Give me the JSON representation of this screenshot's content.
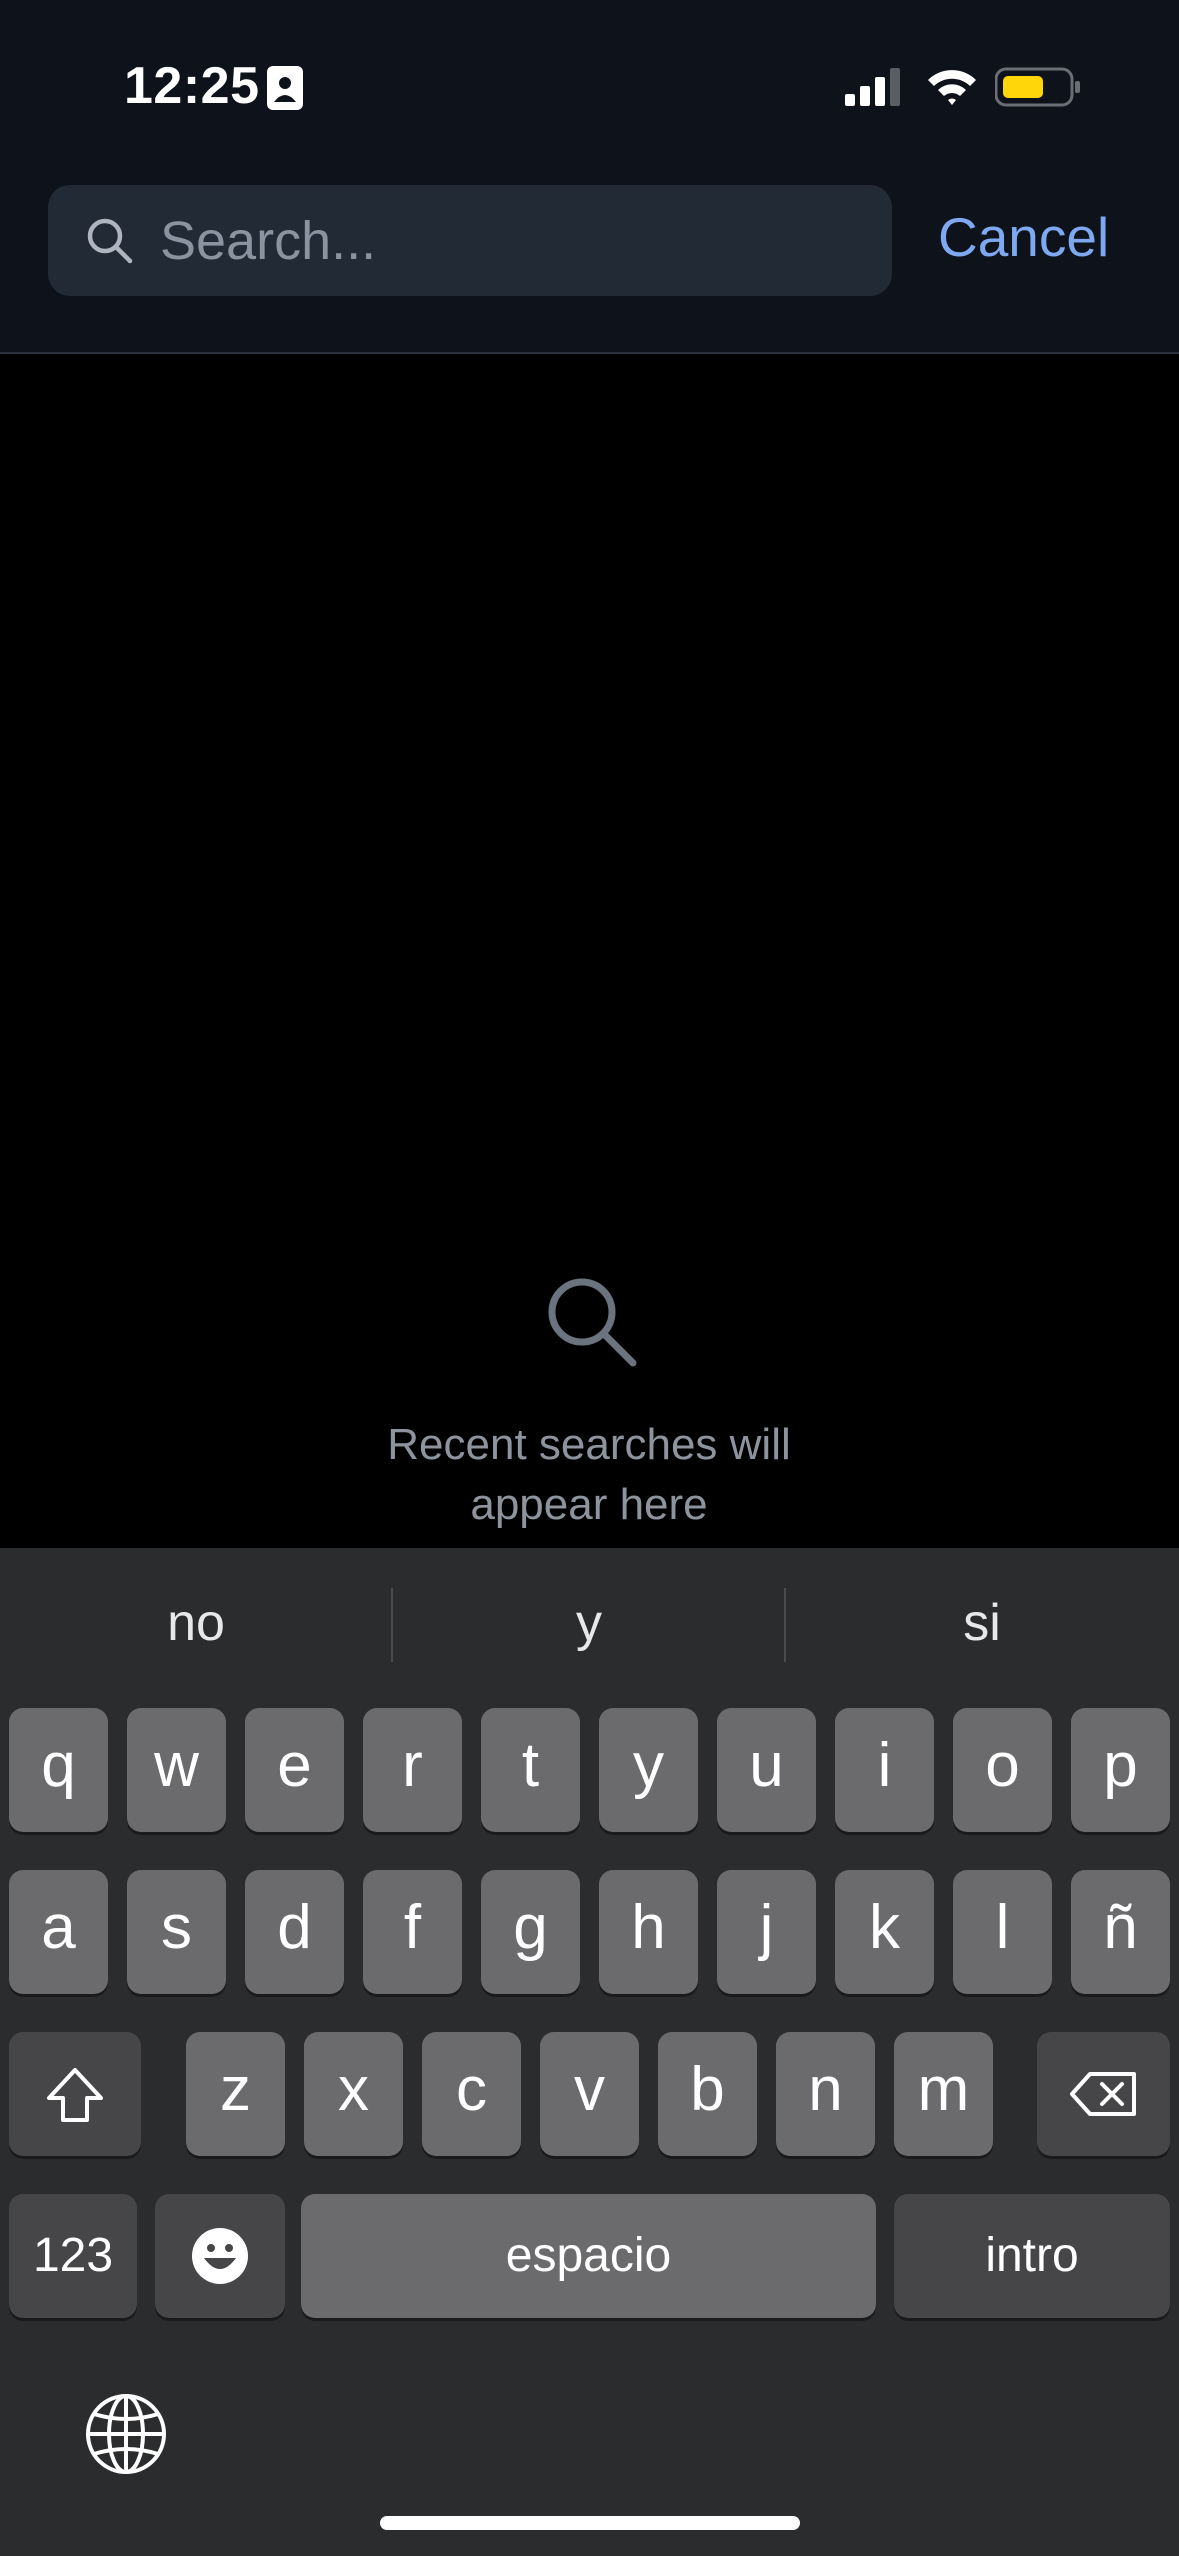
{
  "status_bar": {
    "time": "12:25",
    "icons": [
      "contact-card-icon",
      "signal-icon",
      "wifi-icon",
      "battery-icon"
    ],
    "battery_color": "#ffd60a"
  },
  "search": {
    "placeholder": "Search...",
    "value": "",
    "cancel_label": "Cancel",
    "accent_color": "#7ea8ef"
  },
  "empty_state": {
    "icon": "search-icon",
    "line1": "Recent searches will",
    "line2": "appear here"
  },
  "keyboard": {
    "suggestions": [
      "no",
      "y",
      "si"
    ],
    "row1": [
      "q",
      "w",
      "e",
      "r",
      "t",
      "y",
      "u",
      "i",
      "o",
      "p"
    ],
    "row2": [
      "a",
      "s",
      "d",
      "f",
      "g",
      "h",
      "j",
      "k",
      "l",
      "ñ"
    ],
    "row3": [
      "z",
      "x",
      "c",
      "v",
      "b",
      "n",
      "m"
    ],
    "numbers_label": "123",
    "space_label": "espacio",
    "return_label": "intro",
    "icons": [
      "shift-icon",
      "backspace-icon",
      "emoji-icon",
      "globe-icon"
    ]
  }
}
